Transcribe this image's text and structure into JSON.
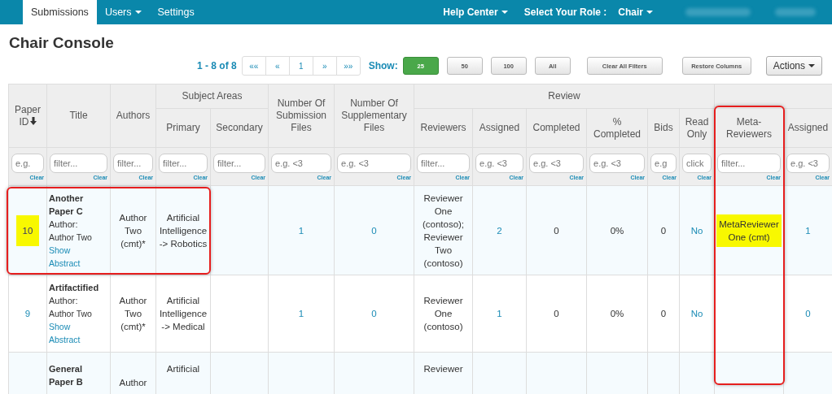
{
  "nav": {
    "items": [
      {
        "label": "Submissions",
        "selected": true,
        "dropdown": false
      },
      {
        "label": "Users",
        "selected": false,
        "dropdown": true
      },
      {
        "label": "Settings",
        "selected": false,
        "dropdown": false
      }
    ],
    "help_center": "Help Center",
    "role_label": "Select Your Role :",
    "role": "Chair"
  },
  "title": "Chair Console",
  "toolbar": {
    "range": "1 - 8 of 8",
    "pager": [
      "««",
      "«",
      "1",
      "»",
      "»»"
    ],
    "show_label": "Show:",
    "page_sizes": [
      {
        "label": "25",
        "selected": true
      },
      {
        "label": "50",
        "selected": false
      },
      {
        "label": "100",
        "selected": false
      },
      {
        "label": "All",
        "selected": false
      }
    ],
    "buttons": [
      "Clear All Filters",
      "Restore Columns"
    ],
    "actions": "Actions"
  },
  "table": {
    "header": [
      {
        "kind": "single",
        "label": "Paper ID",
        "sorted_desc": true,
        "placeholder": "e.g.",
        "clear": "Clear"
      },
      {
        "kind": "single",
        "label": "Title",
        "placeholder": "filter...",
        "clear": "Clear"
      },
      {
        "kind": "single",
        "label": "Authors",
        "placeholder": "filter...",
        "clear": "Clear"
      },
      {
        "kind": "group",
        "label": "Subject Areas",
        "columns": [
          {
            "label": "Primary",
            "placeholder": "filter...",
            "clear": "Clear"
          },
          {
            "label": "Secondary",
            "placeholder": "filter...",
            "clear": "Clear"
          }
        ]
      },
      {
        "kind": "single",
        "label": "Number Of Submission Files",
        "placeholder": "e.g. <3",
        "clear": "Clear"
      },
      {
        "kind": "single",
        "label": "Number Of Supplementary Files",
        "placeholder": "e.g. <3",
        "clear": "Clear"
      },
      {
        "kind": "group",
        "label": "Review",
        "columns": [
          {
            "label": "Reviewers",
            "placeholder": "filter...",
            "clear": "Clear"
          },
          {
            "label": "Assigned",
            "placeholder": "e.g. <3",
            "clear": "Clear"
          },
          {
            "label": "Completed",
            "placeholder": "e.g. <3",
            "clear": "Clear"
          },
          {
            "label": "% Completed",
            "placeholder": "e.g. <3",
            "clear": "Clear"
          },
          {
            "label": "Bids",
            "placeholder": "e.g",
            "clear": "Clear"
          },
          {
            "label": "Read Only",
            "placeholder": "click",
            "clear": "Clear"
          }
        ]
      },
      {
        "kind": "group",
        "columns": [
          {
            "label": "Meta-Reviewers",
            "placeholder": "filter...",
            "clear": "Clear"
          },
          {
            "label": "Assigned",
            "placeholder": "e.g. <3",
            "clear": "Clear"
          }
        ]
      }
    ],
    "rows": [
      {
        "id": "10",
        "id_highlighted": true,
        "title": "Another Paper C",
        "author_label": "Author:",
        "author_name": "Author Two",
        "abstract_link": "Show Abstract",
        "authors": "Author Two (cmt)*",
        "primary": "Artificial Intelligence -> Robotics",
        "submission_files": "1",
        "supplementary_files": "0",
        "reviewers": "Reviewer One (contoso); Reviewer Two (contoso)",
        "assigned": "2",
        "completed": "0",
        "percent_completed": "0%",
        "bids": "0",
        "read_only": "No",
        "meta_reviewers": "MetaReviewer One (cmt)",
        "meta_highlighted": true,
        "meta_assigned": "1"
      },
      {
        "id": "9",
        "id_highlighted": false,
        "title": "Artifactified",
        "author_label": "Author:",
        "author_name": "Author Two",
        "abstract_link": "Show Abstract",
        "authors": "Author Two (cmt)*",
        "primary": "Artificial Intelligence -> Medical",
        "submission_files": "1",
        "supplementary_files": "0",
        "reviewers": "Reviewer One (contoso)",
        "assigned": "1",
        "completed": "0",
        "percent_completed": "0%",
        "bids": "0",
        "read_only": "No",
        "meta_assigned": "0"
      },
      {
        "title": "General Paper B",
        "authors": "Author",
        "primary": "Artificial",
        "reviewers": "Reviewer"
      }
    ]
  }
}
